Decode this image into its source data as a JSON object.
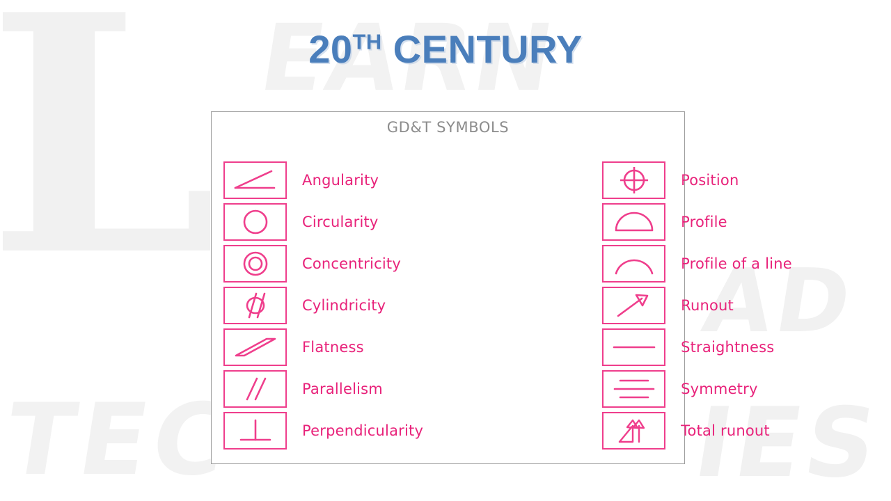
{
  "slide": {
    "title_main": "20",
    "title_sup": "TH",
    "title_rest": " CENTURY",
    "title_full": "20TH CENTURY",
    "title_color": "#4a7ebb",
    "background_color": "#ffffff"
  },
  "watermarks": {
    "left_letter": "L",
    "top_word": "EARN",
    "right_word": "AD",
    "bottom_left_word": "TEC",
    "bottom_right_word": "IES",
    "color": "#f2f2f2"
  },
  "panel": {
    "heading": "GD&T SYMBOLS",
    "heading_color": "#8c8c8c",
    "border_color": "#9e9e9e",
    "symbol_color": "#ef3e8c",
    "label_color": "#e8227a",
    "left_column": [
      {
        "icon": "angularity-symbol",
        "label": "Angularity"
      },
      {
        "icon": "circularity-symbol",
        "label": "Circularity"
      },
      {
        "icon": "concentricity-symbol",
        "label": "Concentricity"
      },
      {
        "icon": "cylindricity-symbol",
        "label": "Cylindricity"
      },
      {
        "icon": "flatness-symbol",
        "label": "Flatness"
      },
      {
        "icon": "parallelism-symbol",
        "label": "Parallelism"
      },
      {
        "icon": "perpendicularity-symbol",
        "label": "Perpendicularity"
      }
    ],
    "right_column": [
      {
        "icon": "position-symbol",
        "label": "Position"
      },
      {
        "icon": "profile-symbol",
        "label": "Profile"
      },
      {
        "icon": "profile-of-a-line-symbol",
        "label": "Profile of a line"
      },
      {
        "icon": "runout-symbol",
        "label": "Runout"
      },
      {
        "icon": "straightness-symbol",
        "label": "Straightness"
      },
      {
        "icon": "symmetry-symbol",
        "label": "Symmetry"
      },
      {
        "icon": "total-runout-symbol",
        "label": "Total runout"
      }
    ]
  }
}
